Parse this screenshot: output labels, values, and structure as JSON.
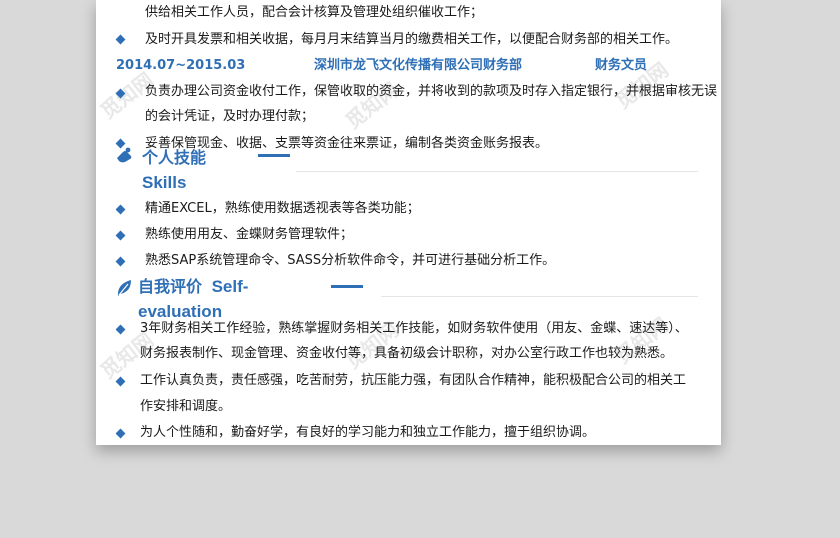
{
  "experience": {
    "lines_before": [
      "供给相关工作人员，配合会计核算及管理处组织催收工作；",
      "及时开具发票和相关收据，每月月末结算当月的缴费相关工作，以便配合财务部的相关工作。"
    ],
    "job": {
      "period": "2014.07~2015.03",
      "company": "深圳市龙飞文化传播有限公司财务部",
      "position": "财务文员"
    },
    "duties": [
      "负责办理公司资金收付工作，保管收取的资金，并将收到的款项及时存入指定银行，并根据审核无误",
      "的会计凭证，及时办理付款；",
      "妥善保管现金、收据、支票等资金往来票证，编制各类资金账务报表。"
    ]
  },
  "skills": {
    "title_cn": "个人技能",
    "title_en": "Skills",
    "items": [
      "精通EXCEL，熟练使用数据透视表等各类功能；",
      "熟练使用用友、金蝶财务管理软件；",
      "熟悉SAP系统管理命令、SASS分析软件命令，并可进行基础分析工作。"
    ]
  },
  "self_eval": {
    "title_cn": "自我评价",
    "title_en_1": "Self-",
    "title_en_2": "evaluation",
    "lines": [
      "3年财务相关工作经验，熟练掌握财务相关工作技能，如财务软件使用（用友、金蝶、速达等）、",
      "财务报表制作、现金管理、资金收付等，具备初级会计职称，对办公室行政工作也较为熟悉。",
      "工作认真负责，责任感强，吃苦耐劳，抗压能力强，有团队合作精神，能积极配合公司的相关工",
      "作安排和调度。",
      "为人个性随和，勤奋好学，有良好的学习能力和独立工作能力，擅于组织协调。"
    ]
  },
  "watermark": "觅知网",
  "colors": {
    "accent": "#2f6fb6",
    "background": "#d9d9d9",
    "paper": "#ffffff"
  },
  "icons": {
    "skills": "hand-icon",
    "self_eval": "leaf-icon"
  }
}
